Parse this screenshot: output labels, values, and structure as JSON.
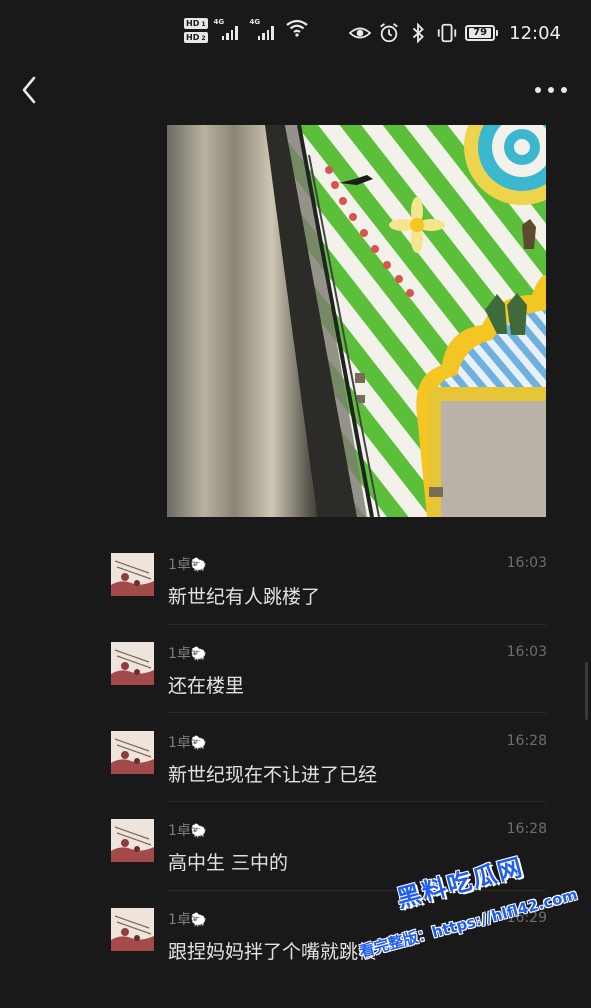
{
  "status_bar": {
    "hd1": "HD",
    "hd1_sub": "1",
    "hd2": "HD",
    "hd2_sub": "2",
    "net1": "4G",
    "net2": "4G",
    "battery": "79",
    "time": "12:04",
    "icons": [
      "eye-icon",
      "alarm-icon",
      "bluetooth-icon",
      "vibrate-icon"
    ]
  },
  "nav": {
    "back_icon": "chevron-left-icon",
    "more_icon": "more-dots-icon"
  },
  "messages": [
    {
      "sender": "1卓",
      "emoji": "🐑",
      "time": "16:03",
      "text": "新世纪有人跳楼了"
    },
    {
      "sender": "1卓",
      "emoji": "🐑",
      "time": "16:03",
      "text": "还在楼里"
    },
    {
      "sender": "1卓",
      "emoji": "🐑",
      "time": "16:28",
      "text": "新世纪现在不让进了已经"
    },
    {
      "sender": "1卓",
      "emoji": "🐑",
      "time": "16:28",
      "text": "高中生 三中的"
    },
    {
      "sender": "1卓",
      "emoji": "🐑",
      "time": "16:29",
      "text": "跟捏妈妈拌了个嘴就跳楼"
    }
  ],
  "watermark": {
    "line1": "黑料吃瓜网",
    "line2": "看完整版：https://hlfl42.com"
  },
  "colors": {
    "background": "#191919",
    "text": "#e2e2e2",
    "meta": "#6e6e6e",
    "watermark": "#1f5ef5"
  }
}
